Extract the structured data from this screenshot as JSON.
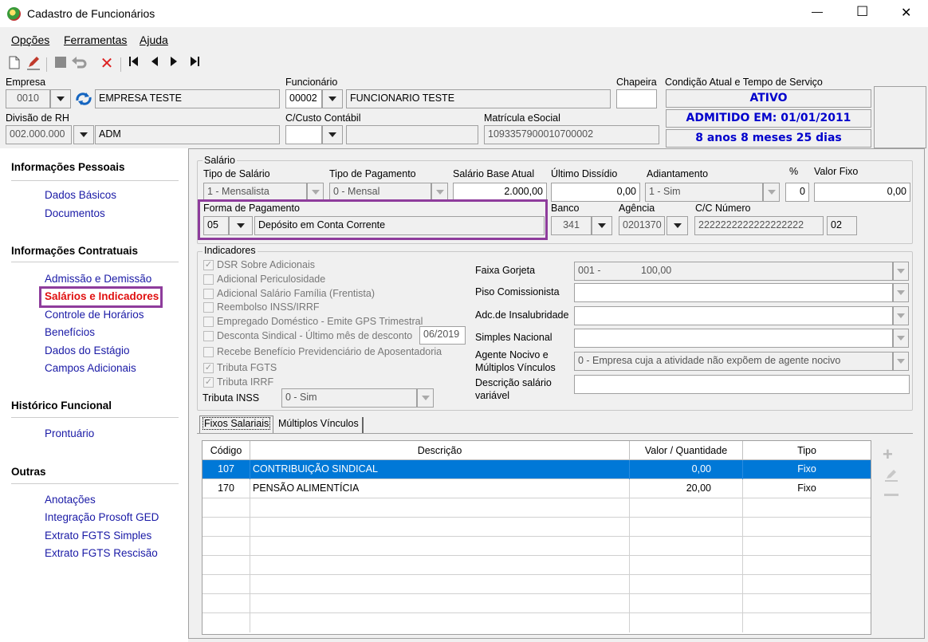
{
  "window": {
    "title": "Cadastro de Funcionários",
    "minimize": "—",
    "maximize": "☐",
    "close": "✕"
  },
  "menu": [
    "Opções",
    "Ferramentas",
    "Ajuda"
  ],
  "header": {
    "empresa_label": "Empresa",
    "empresa_code": "0010",
    "empresa_name": "EMPRESA TESTE",
    "funcionario_label": "Funcionário",
    "funcionario_code": "00002",
    "funcionario_name": "FUNCIONARIO TESTE",
    "chapeira_label": "Chapeira",
    "chapeira_value": "",
    "condicao_label": "Condição Atual e Tempo de Serviço",
    "status": "ATIVO",
    "admitido": "ADMITIDO EM: 01/01/2011",
    "tempo": "8 anos 8 meses 25 dias",
    "divisao_label": "Divisão de RH",
    "divisao_code": "002.000.000",
    "divisao_name": "ADM",
    "ccusto_label": "C/Custo Contábil",
    "ccusto_code": "",
    "ccusto_name": "",
    "matricula_label": "Matrícula eSocial",
    "matricula_value": "1093357900010700002"
  },
  "sidebar": {
    "sections": [
      {
        "title": "Informações Pessoais",
        "items": [
          "Dados Básicos",
          "Documentos"
        ]
      },
      {
        "title": "Informações Contratuais",
        "items": [
          "Admissão e Demissão",
          "Salários e Indicadores",
          "Controle de Horários",
          "Benefícios",
          "Dados do Estágio",
          "Campos Adicionais"
        ]
      },
      {
        "title": "Histórico Funcional",
        "items": [
          "Prontuário"
        ]
      },
      {
        "title": "Outras",
        "items": [
          "Anotações",
          "Integração Prosoft GED",
          "Extrato FGTS Simples",
          "Extrato FGTS Rescisão"
        ]
      }
    ],
    "active_item": "Salários e Indicadores"
  },
  "salario": {
    "group_title": "Salário",
    "tipo_salario_label": "Tipo de Salário",
    "tipo_salario": "1 - Mensalista",
    "tipo_pagamento_label": "Tipo de Pagamento",
    "tipo_pagamento": "0 - Mensal",
    "salario_base_label": "Salário Base Atual",
    "salario_base": "2.000,00",
    "ultimo_dissidio_label": "Último Dissídio",
    "ultimo_dissidio": "0,00",
    "adiantamento_label": "Adiantamento",
    "adiantamento": "1 - Sim",
    "pct_label": "%",
    "pct": "0",
    "valor_fixo_label": "Valor Fixo",
    "valor_fixo": "0,00",
    "forma_pagamento_label": "Forma de Pagamento",
    "forma_pagamento_code": "05",
    "forma_pagamento_desc": "Depósito em Conta Corrente",
    "banco_label": "Banco",
    "banco": "341",
    "agencia_label": "Agência",
    "agencia": "0201370",
    "cc_label": "C/C Número",
    "cc_numero": "2222222222222222222",
    "cc_digito": "02"
  },
  "indicadores": {
    "group_title": "Indicadores",
    "checks": [
      {
        "label": "DSR Sobre Adicionais",
        "checked": true
      },
      {
        "label": "Adicional Periculosidade",
        "checked": false
      },
      {
        "label": "Adicional Salário Família (Frentista)",
        "checked": false
      },
      {
        "label": "Reembolso INSS/IRRF",
        "checked": false
      },
      {
        "label": "Empregado Doméstico - Emite GPS Trimestral",
        "checked": false
      },
      {
        "label": "Desconta Sindical - Último mês de desconto",
        "checked": false
      },
      {
        "label": "Recebe Benefício Previdenciário de Aposentadoria",
        "checked": false
      },
      {
        "label": "Tributa FGTS",
        "checked": true
      },
      {
        "label": "Tributa IRRF",
        "checked": true
      }
    ],
    "ultimo_mes": "06/2019",
    "tributa_inss_label": "Tributa INSS",
    "tributa_inss": "0 - Sim",
    "faixa_gorjeta_label": "Faixa Gorjeta",
    "faixa_gorjeta_code": "001 -",
    "faixa_gorjeta_value": "100,00",
    "piso_label": "Piso Comissionista",
    "piso": "",
    "insalubridade_label": "Adc.de Insalubridade",
    "insalubridade": "",
    "simples_label": "Simples Nacional",
    "simples": "",
    "agente_label_1": "Agente Nocivo e",
    "agente_label_2": "Múltiplos Vínculos",
    "agente": "0 - Empresa cuja a atividade não expõem de agente nocivo",
    "descricao_label_1": "Descrição salário",
    "descricao_label_2": "variável",
    "descricao": ""
  },
  "tabs": [
    "Fixos Salariais",
    "Múltiplos Vínculos"
  ],
  "table": {
    "columns": [
      "Código",
      "Descrição",
      "Valor / Quantidade",
      "Tipo"
    ],
    "rows": [
      {
        "codigo": "107",
        "descricao": "CONTRIBUIÇÃO SINDICAL",
        "valor": "0,00",
        "tipo": "Fixo"
      },
      {
        "codigo": "170",
        "descricao": "PENSÃO ALIMENTÍCIA",
        "valor": "20,00",
        "tipo": "Fixo"
      }
    ]
  },
  "colors": {
    "highlight_box": "#8e3c9c",
    "link": "#1a1aa6",
    "active_link": "#e01010",
    "status_text": "#0000cc",
    "selection": "#0078d7"
  }
}
